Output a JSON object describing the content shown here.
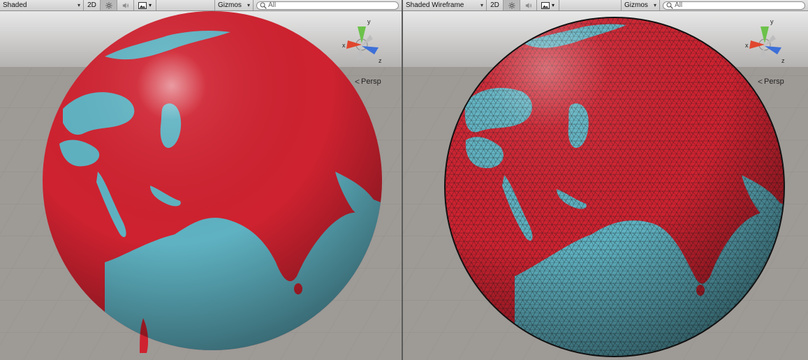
{
  "left_view": {
    "draw_mode": "Shaded",
    "btn_2d": "2D",
    "light_icon": "sun-icon",
    "audio_icon": "speaker-icon",
    "effects_icon": "image-icon",
    "gizmos": "Gizmos",
    "search_placeholder": "All",
    "persp": "Persp",
    "axis_x": "x",
    "axis_y": "y",
    "axis_z": "z"
  },
  "right_view": {
    "draw_mode": "Shaded Wireframe",
    "btn_2d": "2D",
    "light_icon": "sun-icon",
    "audio_icon": "speaker-icon",
    "effects_icon": "image-icon",
    "gizmos": "Gizmos",
    "search_placeholder": "All",
    "persp": "Persp",
    "axis_x": "x",
    "axis_y": "y",
    "axis_z": "z"
  },
  "colors": {
    "globe_red": "#cf2230",
    "ocean": "#5fb2c2",
    "ground": "#9e9a96",
    "sky": "#d8d8d8"
  }
}
